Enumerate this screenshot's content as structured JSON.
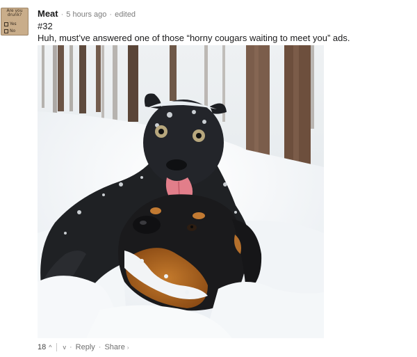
{
  "avatar": {
    "question": "Are you drunk?",
    "options": [
      "Yes",
      "No"
    ]
  },
  "comment": {
    "author": "Meat",
    "time": "5 hours ago",
    "edited": "edited",
    "number": "#32",
    "text": "Huh, must’ve answered one of those “horny cougars waiting to meet you” ads."
  },
  "photo": {
    "subject": "black panther cub and rottweiler playing in snowy forest"
  },
  "actions": {
    "score": "18",
    "upvote_icon": "^",
    "downvote_icon": "v",
    "reply": "Reply",
    "share": "Share",
    "share_chevron": "›"
  }
}
